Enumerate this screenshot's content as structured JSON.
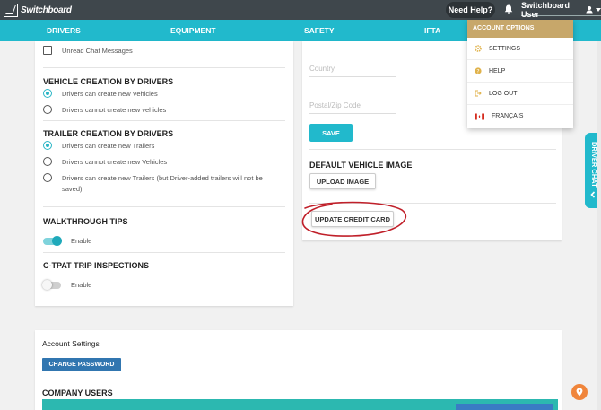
{
  "app": {
    "logo_text": "Switchboard"
  },
  "topbar": {
    "help_label": "Need Help?",
    "user_label": "Switchboard User"
  },
  "nav": {
    "items": [
      "DRIVERS",
      "EQUIPMENT",
      "SAFETY",
      "IFTA"
    ]
  },
  "settings": {
    "unread_chat": "Unread Chat Messages",
    "vehicle_creation": {
      "title": "VEHICLE CREATION BY DRIVERS",
      "options": [
        "Drivers can create new Vehicles",
        "Drivers cannot create new vehicles"
      ]
    },
    "trailer_creation": {
      "title": "TRAILER CREATION BY DRIVERS",
      "options": [
        "Drivers can create new Trailers",
        "Drivers cannot create new Vehicles",
        "Drivers can create new Trailers (but Driver-added trailers will not be",
        "saved)"
      ]
    },
    "walkthrough": {
      "title": "WALKTHROUGH TIPS",
      "label": "Enable",
      "enabled": true
    },
    "ctpat": {
      "title": "C-TPAT TRIP INSPECTIONS",
      "label": "Enable",
      "enabled": false
    }
  },
  "address": {
    "country_placeholder": "Country",
    "postal_placeholder": "Postal/Zip Code",
    "save_label": "SAVE"
  },
  "vehicle_image": {
    "title": "DEFAULT VEHICLE IMAGE",
    "upload_label": "UPLOAD IMAGE"
  },
  "billing": {
    "update_card_label": "UPDATE CREDIT CARD"
  },
  "account_menu": {
    "header": "ACCOUNT OPTIONS",
    "items": [
      "SETTINGS",
      "HELP",
      "LOG OUT",
      "FRANÇAIS"
    ]
  },
  "driver_chat": {
    "label": "DRIVER CHAT"
  },
  "account_settings": {
    "title": "Account Settings",
    "change_password_label": "CHANGE PASSWORD",
    "company_users_title": "COMPANY USERS"
  },
  "colors": {
    "brand_teal": "#21b9cc",
    "topbar": "#3f474c",
    "menu_header": "#c7a76a",
    "button_blue": "#3176b0",
    "annotation_red": "#c0202a"
  }
}
